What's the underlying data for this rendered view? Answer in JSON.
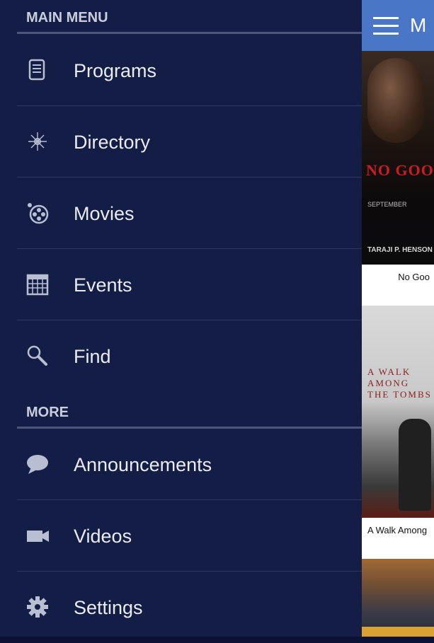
{
  "drawer": {
    "main_menu_header": "MAIN MENU",
    "main_items": [
      {
        "label": "Programs",
        "icon": "document-icon"
      },
      {
        "label": "Directory",
        "icon": "compass-icon"
      },
      {
        "label": "Movies",
        "icon": "film-reel-icon"
      },
      {
        "label": "Events",
        "icon": "calendar-icon"
      },
      {
        "label": "Find",
        "icon": "search-icon"
      }
    ],
    "more_header": "MORE",
    "more_items": [
      {
        "label": "Announcements",
        "icon": "chat-bubble-icon"
      },
      {
        "label": "Videos",
        "icon": "video-camera-icon"
      },
      {
        "label": "Settings",
        "icon": "gear-icon"
      }
    ]
  },
  "content": {
    "app_title": "M",
    "posters": [
      {
        "title_text": "NO GOO",
        "small_text": "SEPTEMBER",
        "credit": "TARAJI P. HENSON",
        "caption": "No Goo"
      },
      {
        "title_text": "A WALK AMONG THE TOMBS",
        "caption": "A Walk Among"
      },
      {
        "caption": ""
      }
    ]
  },
  "colors": {
    "drawer_bg": "#141d45",
    "app_bar": "#4a76c7",
    "text": "#e9ecf3",
    "header_text": "#c9cedc"
  }
}
